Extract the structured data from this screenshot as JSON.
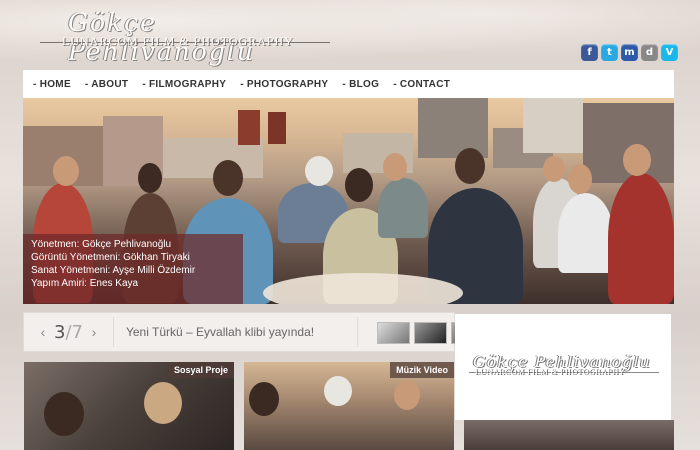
{
  "brand": {
    "script": "Gökçe Pehlivanoğlu",
    "subtitle": "LUNARCOM FILM & PHOTOGRAPHY"
  },
  "socials": [
    {
      "icon": "facebook-icon",
      "glyph": "f",
      "color": "#3b5998"
    },
    {
      "icon": "twitter-icon",
      "glyph": "t",
      "color": "#29a9e1"
    },
    {
      "icon": "myspace-icon",
      "glyph": "m",
      "color": "#2c5aa8"
    },
    {
      "icon": "delicious-icon",
      "glyph": "d",
      "color": "#888888"
    },
    {
      "icon": "vimeo-icon",
      "glyph": "V",
      "color": "#1ab7ea"
    }
  ],
  "nav": [
    "- HOME",
    "- ABOUT",
    "- FILMOGRAPHY",
    "- PHOTOGRAPHY",
    "- BLOG",
    "- CONTACT"
  ],
  "hero": {
    "credits": [
      "Yönetmen: Gökçe Pehlivanoğlu",
      "Görüntü Yönetmeni: Gökhan Tiryaki",
      "Sanat Yönetmeni: Ayşe Milli Özdemir",
      "Yapım Amiri: Enes Kaya"
    ]
  },
  "slider": {
    "current": "3",
    "total": "/7",
    "news": "Yeni Türkü – Eyvallah klibi yayında!"
  },
  "cards": [
    {
      "tag": "Sosyal Proje"
    },
    {
      "tag": "Müzik Video"
    },
    {
      "tag": ""
    }
  ],
  "colors": {
    "nav_bg": "#ffffff",
    "credit_bg": "#6e2828",
    "accent": "#8a3a3a"
  }
}
